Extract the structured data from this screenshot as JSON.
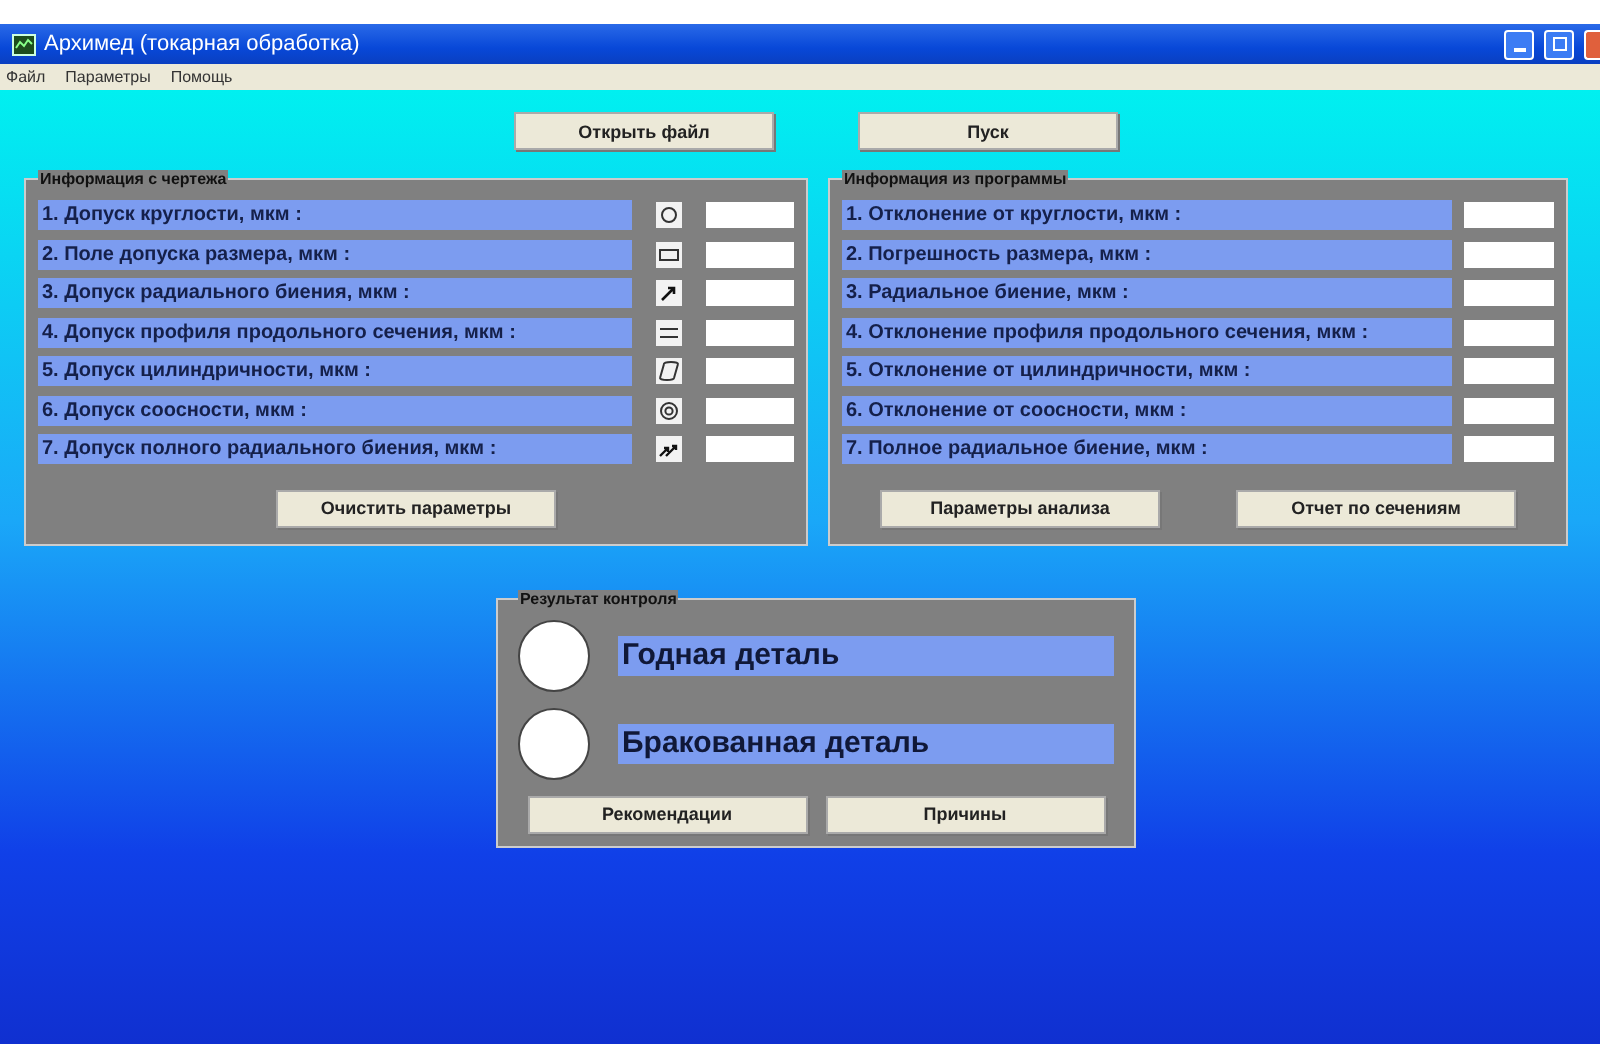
{
  "window": {
    "title": "Архимед (токарная обработка)"
  },
  "menu": [
    "Файл",
    "Параметры",
    "Помощь"
  ],
  "toolbar": [
    "Открыть файл",
    "Пуск"
  ],
  "drawing_panel": {
    "title": "Информация с чертежа",
    "rows": [
      {
        "label": "1. Допуск круглости, мкм :",
        "kind": "circle"
      },
      {
        "label": "2. Поле допуска размера, мкм :",
        "kind": "rectangle"
      },
      {
        "label": "3. Допуск радиального биения, мкм :",
        "kind": "arrow"
      },
      {
        "label": "4. Допуск профиля продольного сечения, мкм :",
        "kind": "lines"
      },
      {
        "label": "5. Допуск цилиндричности, мкм :",
        "kind": "cylinder"
      },
      {
        "label": "6. Допуск соосности, мкм :",
        "kind": "concentric"
      },
      {
        "label": "7. Допуск полного радиального биения, мкм :",
        "kind": "double-arrow"
      }
    ],
    "buttons": [
      "Очистить параметры"
    ]
  },
  "program_panel": {
    "title": "Информация из программы",
    "rows": [
      "1. Отклонение от круглости, мкм :",
      "2. Погрешность размера, мкм :",
      "3. Радиальное биение, мкм :",
      "4. Отклонение профиля продольного сечения, мкм :",
      "5. Отклонение от цилиндричности, мкм :",
      "6. Отклонение от соосности, мкм :",
      "7. Полное радиальное биение, мкм :"
    ],
    "buttons": [
      "Параметры анализа",
      "Отчет по сечениям"
    ]
  },
  "result_panel": {
    "title": "Результат контроля",
    "results": [
      "Годная деталь",
      "Бракованная деталь"
    ],
    "buttons": [
      "Рекомендации",
      "Причины"
    ]
  }
}
